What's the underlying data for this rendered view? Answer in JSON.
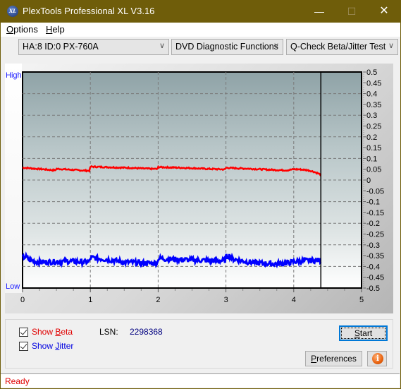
{
  "window": {
    "title": "PlexTools Professional XL V3.16",
    "app_icon": "xl-logo-icon",
    "app_icon_text": "XL",
    "controls": {
      "minimize": "—",
      "maximize": "☐",
      "close": "✕"
    }
  },
  "menu": {
    "items": [
      {
        "label": "Options",
        "accel": "O"
      },
      {
        "label": "Help",
        "accel": "H"
      }
    ]
  },
  "toolbar": {
    "drive_select": "HA:8 ID:0  PX-760A",
    "function_select": "DVD Diagnostic Functions",
    "test_select": "Q-Check Beta/Jitter Test",
    "chevron": "∨"
  },
  "chart_labels": {
    "high": "High",
    "low": "Low"
  },
  "chart_data": {
    "type": "line",
    "title": "",
    "xlabel": "",
    "ylabel": "",
    "xlim": [
      0,
      5
    ],
    "ylim": [
      -0.5,
      0.5
    ],
    "x_ticks": [
      "0",
      "1",
      "2",
      "3",
      "4",
      "5"
    ],
    "y_ticks": [
      "0.5",
      "0.45",
      "0.4",
      "0.35",
      "0.3",
      "0.25",
      "0.2",
      "0.15",
      "0.1",
      "0.05",
      "0",
      "-0.05",
      "-0.1",
      "-0.15",
      "-0.2",
      "-0.25",
      "-0.3",
      "-0.35",
      "-0.4",
      "-0.45",
      "-0.5"
    ],
    "grid": true,
    "marker_x": 4.4,
    "legend": "none",
    "series": [
      {
        "name": "Beta",
        "color": "#ff0000",
        "x": [
          0,
          0.1,
          0.2,
          0.3,
          0.4,
          0.48,
          0.5,
          0.6,
          0.7,
          0.8,
          0.9,
          0.99,
          1.0,
          1.1,
          1.2,
          1.4,
          1.6,
          1.8,
          1.99,
          2.0,
          2.1,
          2.3,
          2.5,
          2.7,
          2.9,
          2.99,
          3.0,
          3.1,
          3.3,
          3.5,
          3.7,
          3.9,
          4.0,
          4.1,
          4.2,
          4.3,
          4.4
        ],
        "values": [
          0.057,
          0.055,
          0.052,
          0.05,
          0.047,
          0.045,
          0.052,
          0.05,
          0.048,
          0.046,
          0.044,
          0.043,
          0.062,
          0.061,
          0.06,
          0.058,
          0.056,
          0.053,
          0.051,
          0.06,
          0.059,
          0.057,
          0.055,
          0.052,
          0.05,
          0.049,
          0.057,
          0.055,
          0.053,
          0.05,
          0.047,
          0.045,
          0.05,
          0.049,
          0.046,
          0.038,
          0.025
        ]
      },
      {
        "name": "Jitter",
        "color": "#0000ff",
        "x": [
          0,
          0.05,
          0.1,
          0.2,
          0.3,
          0.5,
          0.7,
          0.9,
          0.99,
          1.0,
          1.1,
          1.3,
          1.5,
          1.7,
          1.9,
          1.99,
          2.0,
          2.1,
          2.3,
          2.5,
          2.7,
          2.9,
          2.99,
          3.0,
          3.05,
          3.1,
          3.3,
          3.5,
          3.7,
          3.9,
          4.0,
          4.1,
          4.2,
          4.3,
          4.4
        ],
        "values": [
          -0.36,
          -0.355,
          -0.37,
          -0.378,
          -0.38,
          -0.378,
          -0.376,
          -0.38,
          -0.378,
          -0.36,
          -0.362,
          -0.37,
          -0.38,
          -0.383,
          -0.385,
          -0.383,
          -0.362,
          -0.365,
          -0.368,
          -0.37,
          -0.372,
          -0.374,
          -0.372,
          -0.355,
          -0.35,
          -0.365,
          -0.378,
          -0.385,
          -0.388,
          -0.385,
          -0.378,
          -0.375,
          -0.373,
          -0.372,
          -0.372
        ]
      }
    ]
  },
  "controls": {
    "show_beta": {
      "label_pre": "Show ",
      "accel": "B",
      "label_post": "eta",
      "checked": true,
      "color": "#e00000"
    },
    "show_jitter": {
      "label_pre": "Show ",
      "accel": "J",
      "label_post": "itter",
      "checked": true,
      "color": "#0000e0"
    },
    "lsn_label": "LSN:",
    "lsn_value": "2298368",
    "start_button": {
      "accel": "S",
      "rest": "tart"
    },
    "preferences_button": {
      "accel": "P",
      "rest": "references"
    },
    "info_button": "i"
  },
  "status": {
    "text": "Ready"
  }
}
